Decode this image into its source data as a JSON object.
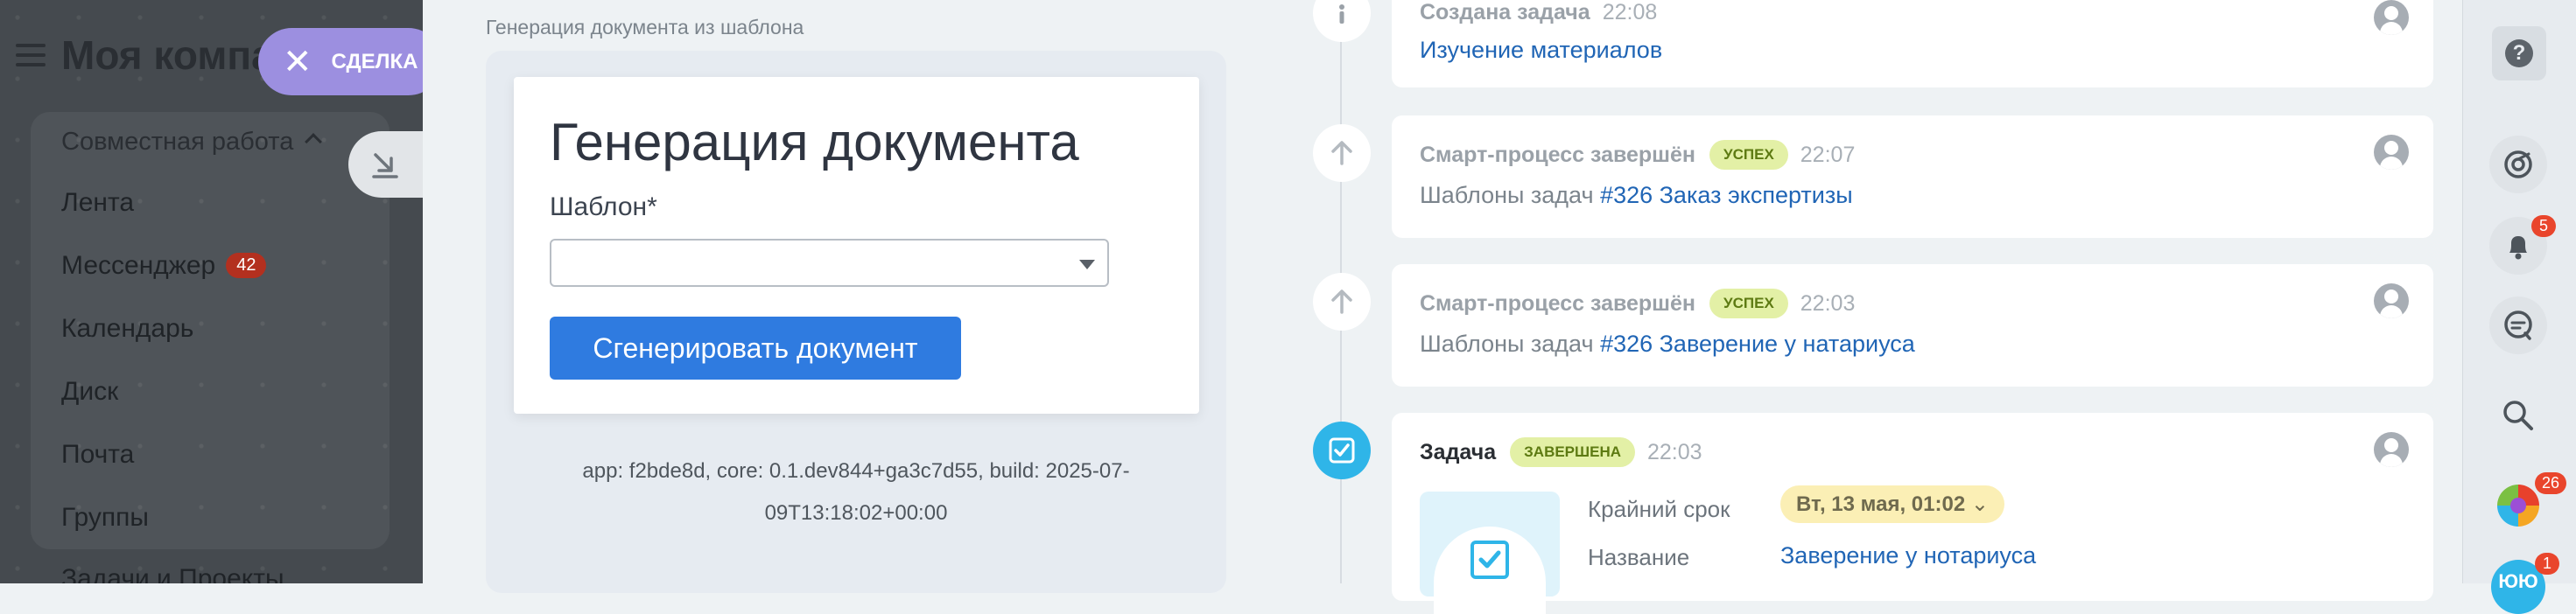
{
  "sidebar": {
    "company_name": "Моя компания",
    "group_label": "Совместная работа",
    "items": [
      {
        "label": "Лента"
      },
      {
        "label": "Мессенджер",
        "badge": "42"
      },
      {
        "label": "Календарь"
      },
      {
        "label": "Диск"
      },
      {
        "label": "Почта"
      },
      {
        "label": "Группы"
      },
      {
        "label": "Задачи и Проекты"
      }
    ]
  },
  "slider_tab": {
    "label": "СДЕЛКА"
  },
  "doc_generator": {
    "slider_title": "Генерация документа из шаблона",
    "title": "Генерация документа",
    "template_label": "Шаблон*",
    "template_value": "",
    "generate_button": "Сгенерировать документ",
    "build_info": "app: f2bde8d, core: 0.1.dev844+ga3c7d55, build: 2025-07-09T13:18:02+00:00"
  },
  "timeline": [
    {
      "title": "Создана задача",
      "time": "22:08",
      "body_link": "Изучение материалов"
    },
    {
      "title": "Смарт-процесс завершён",
      "tag": "УСПЕХ",
      "time": "22:07",
      "body_prefix": "Шаблоны задач",
      "body_link": "#326 Заказ экспертизы"
    },
    {
      "title": "Смарт-процесс завершён",
      "tag": "УСПЕХ",
      "time": "22:03",
      "body_prefix": "Шаблоны задач",
      "body_link": "#326 Заверение у натариуса"
    },
    {
      "title": "Задача",
      "tag": "ЗАВЕРШЕНА",
      "time": "22:03",
      "deadline_label": "Крайний срок",
      "deadline_value": "Вт, 13 мая, 01:02",
      "name_label": "Название",
      "name_value": "Заверение у нотариуса"
    }
  ],
  "rail": {
    "notifications_badge": "5",
    "apps_badge": "26",
    "profile_badge": "1",
    "profile_initials": "ЮЮ"
  },
  "colors": {
    "accent": "#2f7be0",
    "tl_icon_active": "#2fb5e8",
    "deal_pill": "#9c8fe0",
    "badge_red": "#e9452c"
  }
}
